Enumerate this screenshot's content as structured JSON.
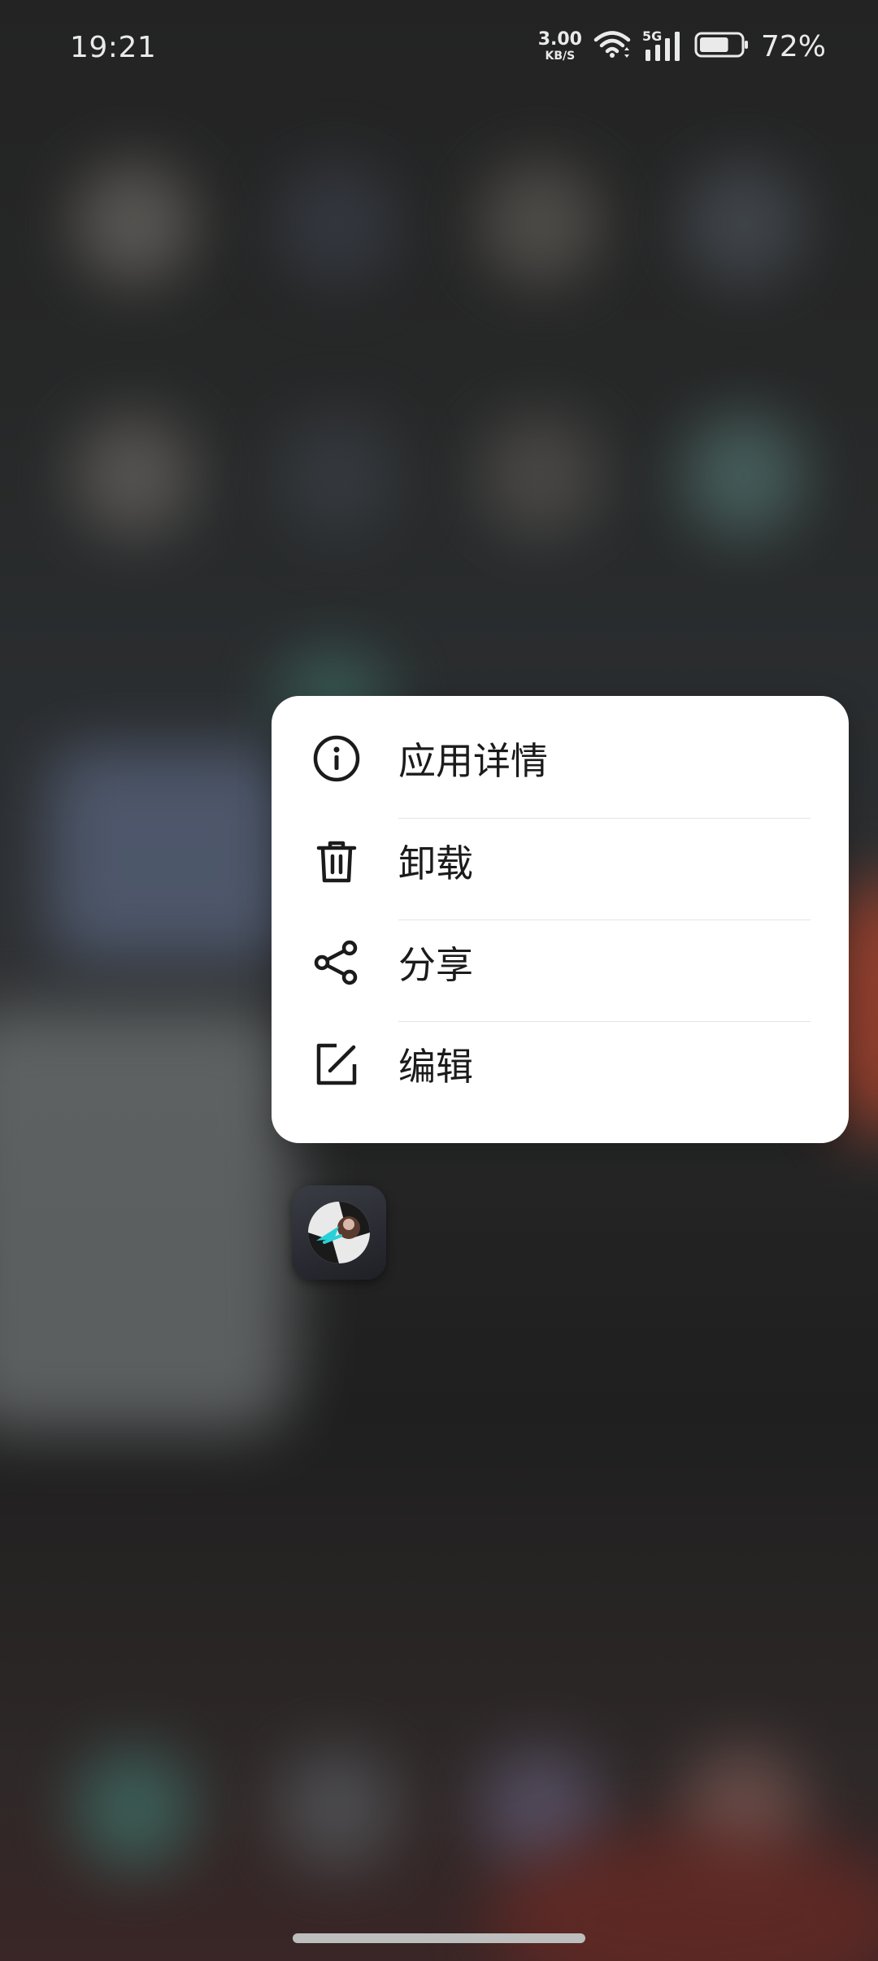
{
  "status_bar": {
    "time": "19:21",
    "net_speed_value": "3.00",
    "net_speed_unit": "KB/S",
    "network_type": "5G",
    "battery_percent": "72%",
    "battery_level": 0.72
  },
  "context_menu": {
    "items": [
      {
        "label": "应用详情",
        "icon": "info-icon"
      },
      {
        "label": "卸载",
        "icon": "trash-icon"
      },
      {
        "label": "分享",
        "icon": "share-icon"
      },
      {
        "label": "编辑",
        "icon": "edit-icon"
      }
    ]
  },
  "colors": {
    "menu_background": "#ffffff",
    "menu_text": "#1b1b1b",
    "icon_stroke": "#1b1b1b",
    "divider": "#e4e4e4"
  }
}
